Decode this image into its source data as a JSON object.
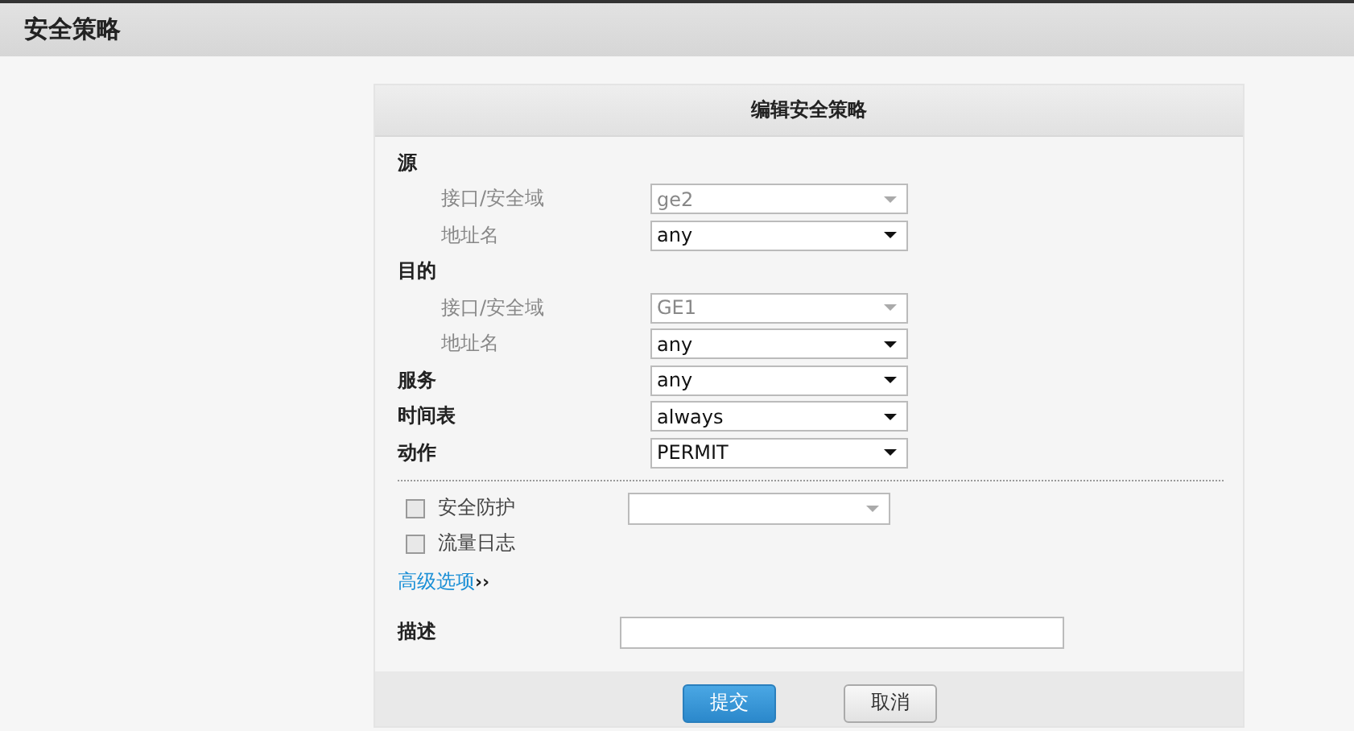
{
  "page_title": "安全策略",
  "panel": {
    "title": "编辑安全策略",
    "rows": [
      {
        "kind": "heading",
        "label": "源"
      },
      {
        "kind": "sub",
        "label": "接口/安全域",
        "value": "ge2",
        "disabled": true
      },
      {
        "kind": "sub",
        "label": "地址名",
        "value": "any",
        "disabled": false
      },
      {
        "kind": "heading",
        "label": "目的"
      },
      {
        "kind": "sub",
        "label": "接口/安全域",
        "value": "GE1",
        "disabled": true
      },
      {
        "kind": "sub",
        "label": "地址名",
        "value": "any",
        "disabled": false
      },
      {
        "kind": "main",
        "label": "服务",
        "value": "any",
        "disabled": false
      },
      {
        "kind": "main",
        "label": "时间表",
        "value": "always",
        "disabled": false
      },
      {
        "kind": "main",
        "label": "动作",
        "value": "PERMIT",
        "disabled": false
      }
    ],
    "options": [
      {
        "label": "安全防护",
        "checked": false,
        "has_select": true
      },
      {
        "label": "流量日志",
        "checked": false,
        "has_select": false
      }
    ],
    "advanced": {
      "link": "高级选项",
      "chevron": "››"
    },
    "description": {
      "label": "描述"
    },
    "buttons": [
      {
        "label": "提交",
        "kind": "primary"
      },
      {
        "label": "取消",
        "kind": "secondary"
      }
    ]
  }
}
